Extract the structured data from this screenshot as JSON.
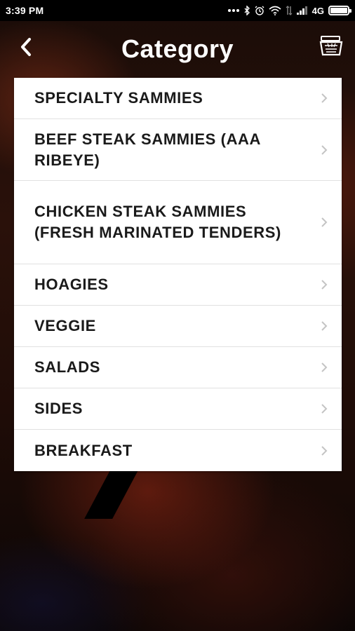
{
  "status_bar": {
    "time": "3:39 PM",
    "network": "4G",
    "icons": [
      "more-dots-icon",
      "bluetooth-icon",
      "alarm-icon",
      "wifi-icon",
      "signal-icon",
      "battery-icon"
    ]
  },
  "header": {
    "title": "Category",
    "back_icon": "chevron-left-icon",
    "cart_icon": "cart-icon"
  },
  "categories": [
    {
      "label": "SPECIALTY SAMMIES"
    },
    {
      "label": "BEEF STEAK SAMMIES (AAA RIBEYE)"
    },
    {
      "label": "CHICKEN STEAK SAMMIES (FRESH MARINATED TENDERS)"
    },
    {
      "label": "HOAGIES"
    },
    {
      "label": "VEGGIE"
    },
    {
      "label": "SALADS"
    },
    {
      "label": "SIDES"
    },
    {
      "label": "BREAKFAST"
    }
  ],
  "colors": {
    "list_background": "#ffffff",
    "text": "#1a1a1a",
    "header_text": "#ffffff",
    "chevron": "#c4c4c4"
  }
}
